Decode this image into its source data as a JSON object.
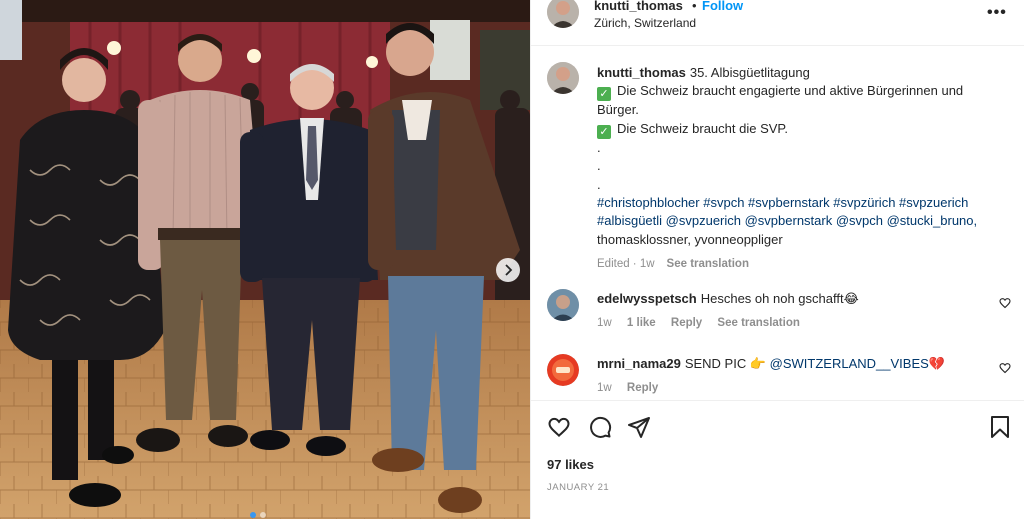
{
  "post": {
    "author": "knutti_thomas",
    "separator": "•",
    "follow_label": "Follow",
    "location": "Zürich, Switzerland",
    "more_label": "•••"
  },
  "caption": {
    "username": "knutti_thomas",
    "title": "35. Albisgüetlitagung",
    "line1": "Die Schweiz braucht engagierte und aktive Bürgerinnen und Bürger.",
    "line2": "Die Schweiz braucht die SVP.",
    "dot1": ".",
    "dot2": ".",
    "dot3": ".",
    "hashtags": "#christophblocher #svpch #svpbernstark #svpzürich #svpzuerich #albisgüetli @svpzuerich @svpbernstark @svpch @stucki_bruno,",
    "mentions_plain": "thomasklossner, yvonneoppliger",
    "edited": "Edited · 1w",
    "see_translation": "See translation"
  },
  "comments": [
    {
      "username": "edelwysspetsch",
      "text": "Hesches oh noh gschafft😂",
      "time": "1w",
      "likes": "1 like",
      "reply": "Reply",
      "see_translation": "See translation"
    },
    {
      "username": "mrni_nama29",
      "text": "SEND PIC 👉",
      "tag": "@SWITZERLAND__VIBES💔",
      "time": "1w",
      "reply": "Reply"
    }
  ],
  "stats": {
    "likes": "97 likes",
    "date": "JANUARY 21"
  },
  "colors": {
    "follow": "#0095f6",
    "hashtag": "#00376b",
    "muted": "#8e8e8e",
    "check": "#4caf50"
  },
  "icons": [
    "chevron-right-icon",
    "more-icon",
    "heart-icon",
    "comment-icon",
    "share-icon",
    "bookmark-icon",
    "check-icon"
  ]
}
